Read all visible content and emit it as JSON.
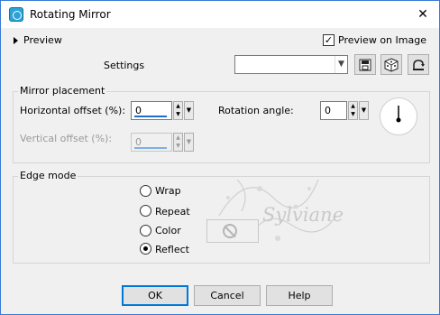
{
  "window": {
    "title": "Rotating Mirror"
  },
  "top": {
    "preview_toggle": "Preview",
    "preview_on_image": {
      "label": "Preview on Image",
      "checked": true
    },
    "settings_label": "Settings",
    "settings_value": "",
    "icons": [
      "save-settings-icon",
      "randomize-dice-icon",
      "reset-defaults-icon"
    ]
  },
  "mirror": {
    "title": "Mirror placement",
    "horizontal_label": "Horizontal offset (%):",
    "horizontal_value": "0",
    "vertical_label": "Vertical offset (%):",
    "vertical_value": "0",
    "vertical_enabled": false,
    "rotation_label": "Rotation angle:",
    "rotation_value": "0",
    "rotation_dial_degrees": 0
  },
  "edge": {
    "title": "Edge mode",
    "options": [
      {
        "label": "Wrap",
        "selected": false
      },
      {
        "label": "Repeat",
        "selected": false
      },
      {
        "label": "Color",
        "selected": false
      },
      {
        "label": "Reflect",
        "selected": true
      }
    ],
    "color_swatch_state": "disabled"
  },
  "watermark": {
    "text": "Sylviane"
  },
  "buttons": {
    "ok": "OK",
    "cancel": "Cancel",
    "help": "Help"
  },
  "colors": {
    "accent": "#0078d7",
    "frame": "#3a7bd5",
    "dialog_bg": "#f0f0f0"
  }
}
